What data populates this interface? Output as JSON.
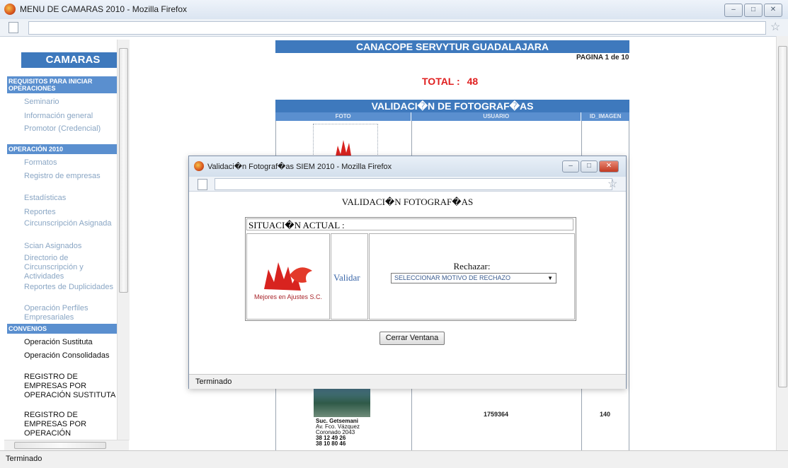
{
  "window": {
    "title": "MENU DE CAMARAS 2010 - Mozilla Firefox",
    "status": "Terminado"
  },
  "sidebar": {
    "title": "CAMARAS",
    "sections": [
      {
        "header": "REQUISITOS PARA INICIAR OPERACIONES",
        "items": [
          "Seminario",
          "Información general",
          "Promotor (Credencial)"
        ]
      },
      {
        "header": "OPERACIÓN 2010",
        "items": [
          "Formatos",
          "Registro de empresas",
          "Estadísticas",
          "Reportes",
          "Circunscripción Asignada",
          "Scian Asignados",
          "Directorio de Circunscripción y Actividades",
          "Reportes de Duplicidades",
          "Operación Perfiles Empresariales"
        ]
      },
      {
        "header": "CONVENIOS",
        "items": [
          "Operación Sustituta",
          "Operación Consolidadas",
          "REGISTRO DE EMPRESAS POR OPERACIÓN SUSTITUTA",
          "REGISTRO DE EMPRESAS POR OPERACIÓN"
        ]
      }
    ]
  },
  "content": {
    "banner": "CANACOPE SERVYTUR GUADALAJARA",
    "pagina": "PAGINA 1 de 10",
    "total_label": "TOTAL :",
    "total_value": "48",
    "table_title": "VALIDACI�N DE FOTOGRAF�AS",
    "columns": [
      "FOTO",
      "USUARIO",
      "ID_IMAGEN"
    ],
    "row": {
      "caption_name": "Suc. Getsemani",
      "caption_l1": "Av. Fco. Vázquez",
      "caption_l2": "Coronado 2043",
      "caption_l3": "38 12 49 26",
      "caption_l4": "38 10 80 46",
      "usuario": "1759364",
      "id_imagen": "140"
    }
  },
  "popup": {
    "title": "Validaci�n Fotograf�as SIEM 2010 - Mozilla Firefox",
    "heading": "VALIDACI�N FOTOGRAF�AS",
    "situacion": "SITUACI�N ACTUAL :",
    "logo_text": "Mejores en Ajustes S.C.",
    "validar": "Validar",
    "rechazar_label": "Rechazar:",
    "rechazar_select": "SELECCIONAR MOTIVO DE RECHAZO",
    "close_button": "Cerrar Ventana",
    "status": "Terminado"
  }
}
